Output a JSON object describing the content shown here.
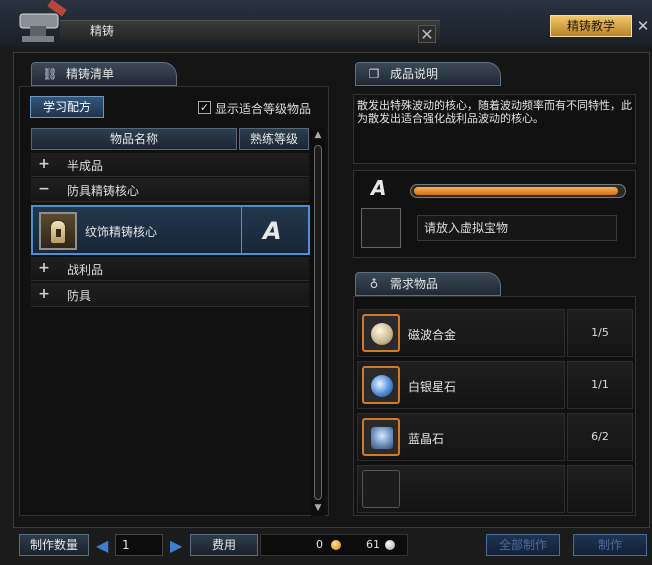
{
  "window": {
    "title": "精铸",
    "tutorial_button": "精铸教学",
    "close_glyph": "✕"
  },
  "left": {
    "section_title": "精铸清单",
    "learn_button": "学习配方",
    "filter_checkbox_label": "显示适合等级物品",
    "filter_checked": true,
    "columns": [
      "物品名称",
      "熟练等级"
    ],
    "tree": [
      {
        "sign": "+",
        "label": "半成品"
      },
      {
        "sign": "−",
        "label": "防具精铸核心"
      },
      {
        "sign": "+",
        "label": "战利品"
      },
      {
        "sign": "+",
        "label": "防具"
      }
    ],
    "selected_item": {
      "name": "纹饰精铸核心",
      "grade": "A",
      "icon": "rune-stone-icon"
    }
  },
  "right": {
    "result_title": "成品说明",
    "description": "散发出特殊波动的核心，随着波动频率而有不同特性，此为散发出适合强化战利品波动的核心。",
    "grade": "A",
    "grade_progress": 0.98,
    "virtual_item_placeholder": "请放入虚拟宝物",
    "requirements_title": "需求物品",
    "requirements": [
      {
        "name": "磁波合金",
        "count": "1/5",
        "icon": "alloy-icon",
        "color": "#d8cdb4"
      },
      {
        "name": "白银星石",
        "count": "1/1",
        "icon": "silver-star-stone-icon",
        "color": "#5f9de0"
      },
      {
        "name": "蓝晶石",
        "count": "6/2",
        "icon": "blue-crystal-icon",
        "color": "#7fa0c8"
      },
      {
        "name": "",
        "count": "",
        "icon": "",
        "color": ""
      }
    ]
  },
  "bottom": {
    "qty_label": "制作数量",
    "qty_value": "1",
    "fee_label": "费用",
    "cost_gold": "0",
    "cost_silver": "61",
    "craft_all": "全部制作",
    "craft": "制作"
  },
  "colors": {
    "accent_blue": "#4f8fcf",
    "tutorial_gold": "#f0c86a",
    "progress_orange": "#f08a20"
  }
}
